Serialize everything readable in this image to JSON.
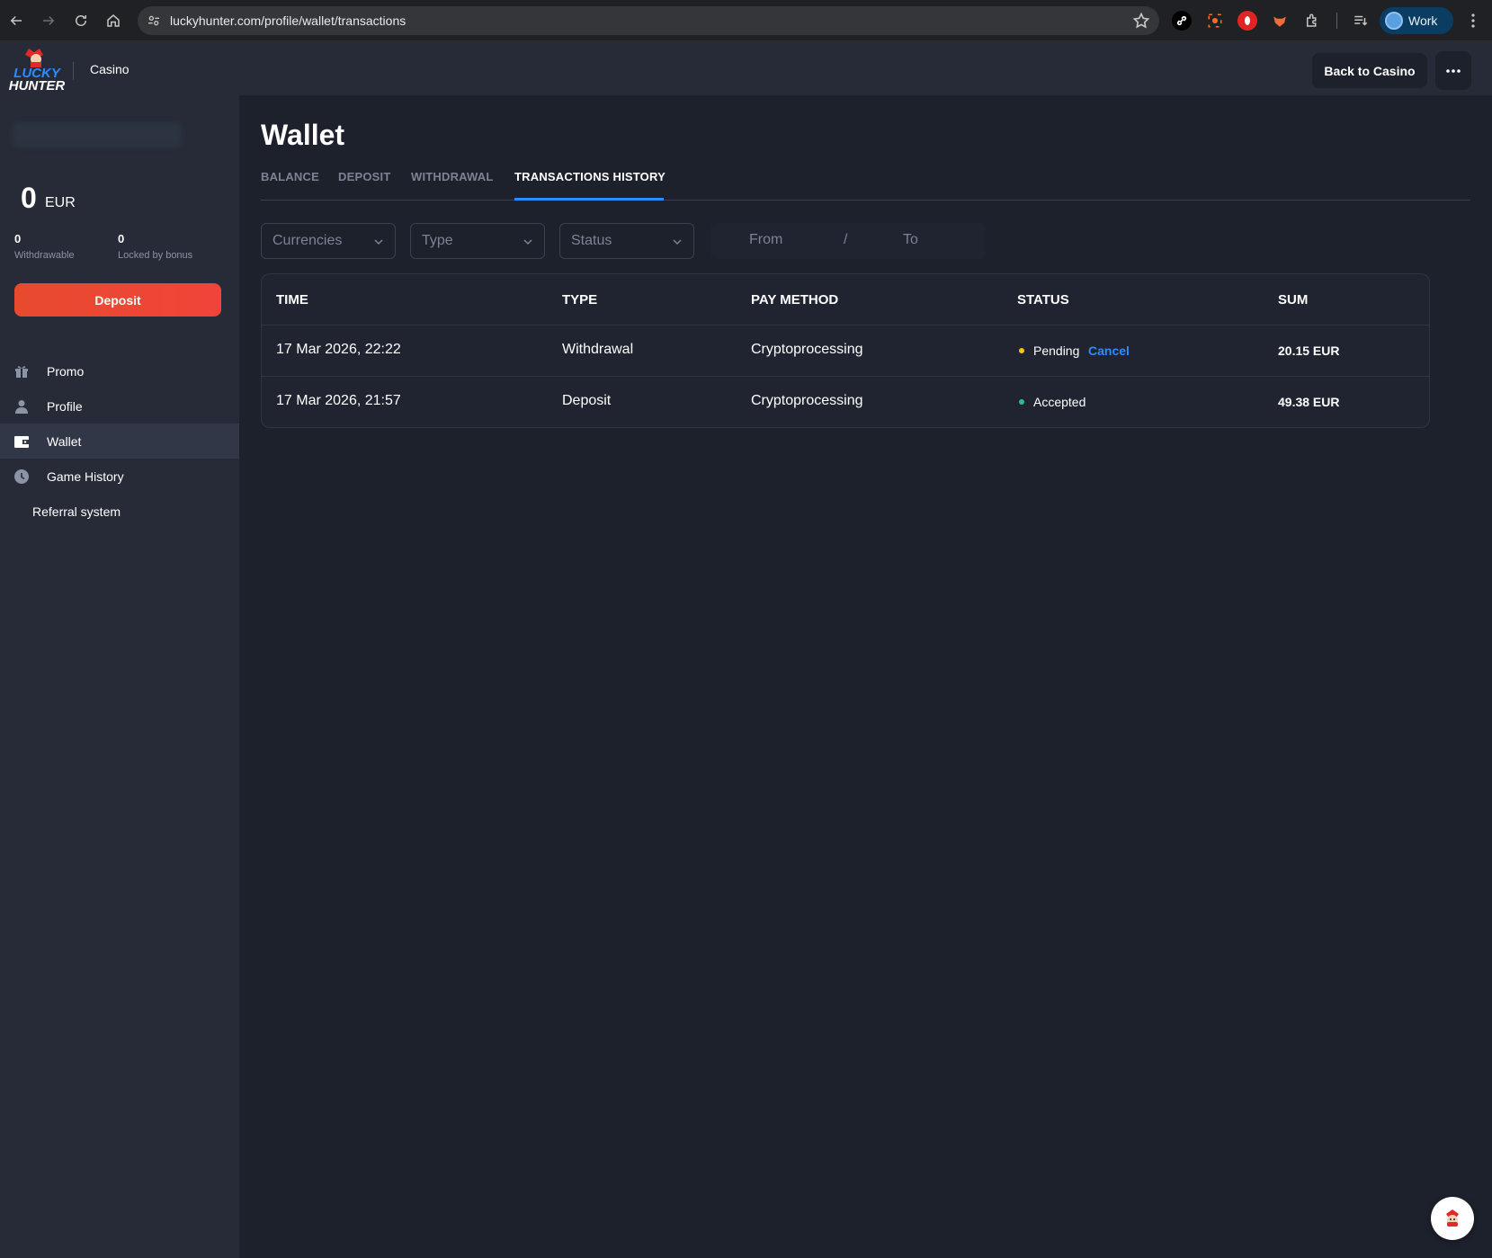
{
  "browser": {
    "url": "luckyhunter.com/profile/wallet/transactions",
    "profile_label": "Work"
  },
  "header": {
    "logo_top": "LUCKY",
    "logo_bottom": "HUNTER",
    "section": "Casino",
    "back_button": "Back to Casino"
  },
  "sidebar": {
    "balance_value": "0",
    "balance_currency": "EUR",
    "withdrawable_value": "0",
    "withdrawable_label": "Withdrawable",
    "locked_value": "0",
    "locked_label": "Locked by bonus",
    "deposit_button": "Deposit",
    "items": [
      {
        "label": "Promo",
        "icon": "gift-icon"
      },
      {
        "label": "Profile",
        "icon": "user-icon"
      },
      {
        "label": "Wallet",
        "icon": "wallet-icon",
        "active": true
      },
      {
        "label": "Game History",
        "icon": "clock-icon"
      },
      {
        "label": "Referral system"
      }
    ]
  },
  "main": {
    "title": "Wallet",
    "tabs": [
      {
        "label": "BALANCE"
      },
      {
        "label": "DEPOSIT"
      },
      {
        "label": "WITHDRAWAL"
      },
      {
        "label": "TRANSACTIONS HISTORY",
        "active": true
      }
    ],
    "filters": {
      "currencies": "Currencies",
      "type": "Type",
      "status": "Status",
      "date_from": "From",
      "date_sep": "/",
      "date_to": "To"
    },
    "table": {
      "headers": [
        "TIME",
        "TYPE",
        "PAY METHOD",
        "STATUS",
        "SUM"
      ],
      "rows": [
        {
          "time": "17 Mar 2026, 22:22",
          "type": "Withdrawal",
          "method": "Cryptoprocessing",
          "status": "Pending",
          "status_color": "#f5c518",
          "action": "Cancel",
          "sum": "20.15 EUR"
        },
        {
          "time": "17 Mar 2026, 21:57",
          "type": "Deposit",
          "method": "Cryptoprocessing",
          "status": "Accepted",
          "status_color": "#27c08a",
          "sum": "49.38 EUR"
        }
      ]
    }
  },
  "colors": {
    "accent": "#2b8cff",
    "deposit": "#ef4534",
    "background": "#1d212c",
    "sidebar": "#262b37"
  }
}
